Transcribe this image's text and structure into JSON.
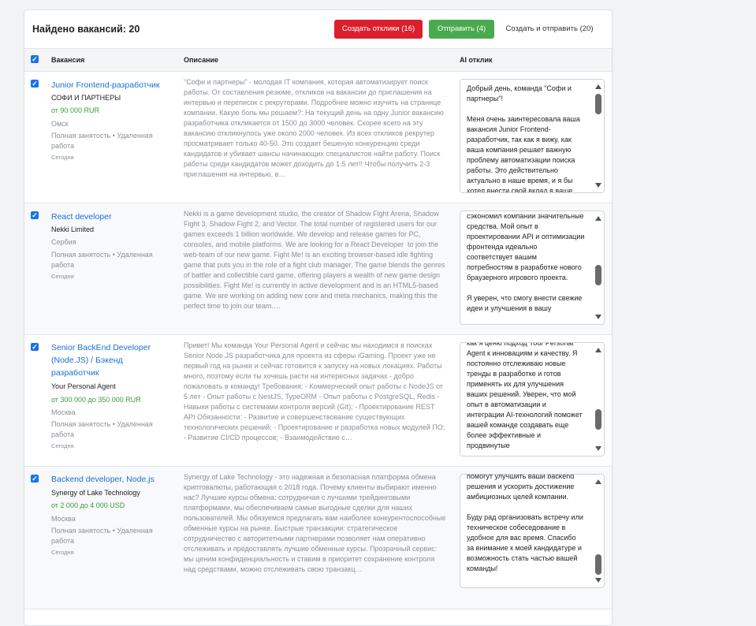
{
  "header": {
    "title": "Найдено вакансий: 20",
    "btn_create": "Создать отклики (16)",
    "btn_send": "Отправить (4)",
    "btn_create_send": "Создать и отправить (20)"
  },
  "columns": {
    "vacancy": "Вакансия",
    "description": "Описание",
    "ai": "AI отклик"
  },
  "colors": {
    "accent_blue": "#1a73e8",
    "red": "#dc1f2d",
    "green": "#4aaa4f",
    "salary_green": "#3c9a3f"
  },
  "rows": [
    {
      "title": "Junior Frontend-разработчик",
      "company": "СОФИ И ПАРТНЕРЫ",
      "salary": "от 90 000 RUR",
      "city": "Омск",
      "employment": "Полная занятость • Удаленная работа",
      "date": "Сегодня",
      "description": "\"Софи и партнеры\" - молодая IT компания, которая автоматизирует поиск работы. От составления резюме, откликов на вакансии до приглашения на интервью и переписок с рекрутерами. Подробнее можно изучить на странице компании. Какую боль мы решаем?: На текущий день на одну Junior вакансию разработчика откликается от 1500 до 3000 человек. Скорее всего на эту вакансию откликнулось уже около 2000 человек. Из всех откликов рекрутер просматривает только 40-50. Это создает бешеную конкуренцию среди кандидатов и убивает шансы начинающих специалистов найти работу. Поиск работы среди кандидатов может доходить до 1.5 лет!! Чтобы получить 2-3 приглашения на интервью, в…",
      "reply": "Добрый день, команда \"Софи и партнеры\"!\n\nМеня очень заинтересовала ваша вакансия Junior Frontend-разработчик, так как я вижу, как ваша компания решает важную проблему автоматизации поиска работы. Это действительно актуально в наше время, и я бы хотел внести свой вклад в ваше"
    },
    {
      "title": "React developer",
      "company": "Nekki Limited",
      "salary": "",
      "city": "Сербия",
      "employment": "Полная занятость • Удаленная работа",
      "date": "Сегодня",
      "description": "Nekki is a game development studio, the creator of Shadow Fight Arena, Shadow Fight 3, Shadow Fight 2, and Vector. The total number of registered users for our games exceeds 1 billion worldwide. We develop and release games for PC, consoles, and mobile platforms. We are looking for a React Developer  to join the web-team of our new game. Fight Me! is an exciting browser-based idle fighting game that puts you in the role of a fight club manager. The game blends the genres of battler and collectible card game, offering players a wealth of new game design possibilities. Fight Me! is currently in active development and is an HTML5-based game. We are working on adding new core and meta mechanics, making this the perfect time to join our team.…",
      "reply": "сэкономил компании значительные средства. Мой опыт в проектировании API и оптимизации фронтенда идеально соответствует вашим потребностям в разработке нового браузерного игрового проекта.\n\nЯ уверен, что смогу внести свежие идеи и улучшения в вашу"
    },
    {
      "title": "Senior BackEnd Developer (Node.JS) / Бэкенд разработчик",
      "company": "Your Personal Agent",
      "salary": "от 300 000 до 350 000 RUR",
      "city": "Москва",
      "employment": "Полная занятость • Удаленная работа",
      "date": "Сегодня",
      "description": "Привет! Мы команда Your Personal Agent и сейчас мы находимся в поисках Senior Node.JS разработчика для проекта из сферы iGaming. Проект уже не первый год на рынке и сейчас готовится к запуску на новых локациях. Работы много, поэтому если ты хочешь расти на интересных задачах - добро пожаловать в команду! Требования: - Коммерческий опыт работы с NodeJS от 5 лет - Опыт работы с NestJS, TypeORM - Опыт работы с PostgreSQL, Redis - Навыки работы с системами контроля версий (Git); - Проектирование REST API Обязанности: - Развитие и совершенствование существующих технологических решений; - Проектирование и разработка новых модулей ПО; - Развитие CI/CD процессов; - Взаимодействие с…",
      "reply": "как я ценю подход Your Personal Agent к инновациям и качеству. Я постоянно отслеживаю новые тренды в разработке и готов применять их для улучшения ваших решений. Уверен, что мой опыт в автоматизации и интеграции AI-технологий поможет вашей команде создавать еще более эффективные и продвинутые"
    },
    {
      "title": "Backend developer, Node.js",
      "company": "Synergy of Lake Technology",
      "salary": "от 2 000 до 4 000 USD",
      "city": "Москва",
      "employment": "Полная занятость • Удаленная работа",
      "date": "Сегодня",
      "description": "Synergy of Lake Technology - это надежная и безопасная платформа обмена криптовалюты, работающая с 2018 года. Почему клиенты выбирают именно нас? Лучшие курсы обмена: сотрудничая с лучшими трейдинговыми платформами, мы обеспечиваем самые выгодные сделки для наших пользователей. Мы обязуемся предлагать вам наиболее конкурентоспособные обменные курсы на рынке. Быстрые транзакции: стратегическое сотрудничество с авторитетными партнерами позволяет нам оперативно отслеживать и предоставлять лучшие обменные курсы. Прозрачный сервис: мы ценим конфиденциальность и ставим в приоритет сохранение контроля над средствами, можно отслеживать свою транзакц…",
      "reply": "помогут улучшить ваши backend решения и ускорить достижение амбициозных целей компании.\n\nБуду рад организовать встречу или техническое собеседование в удобное для вас время. Спасибо за внимание к моей кандидатуре и возможность стать частью вашей команды!"
    }
  ]
}
